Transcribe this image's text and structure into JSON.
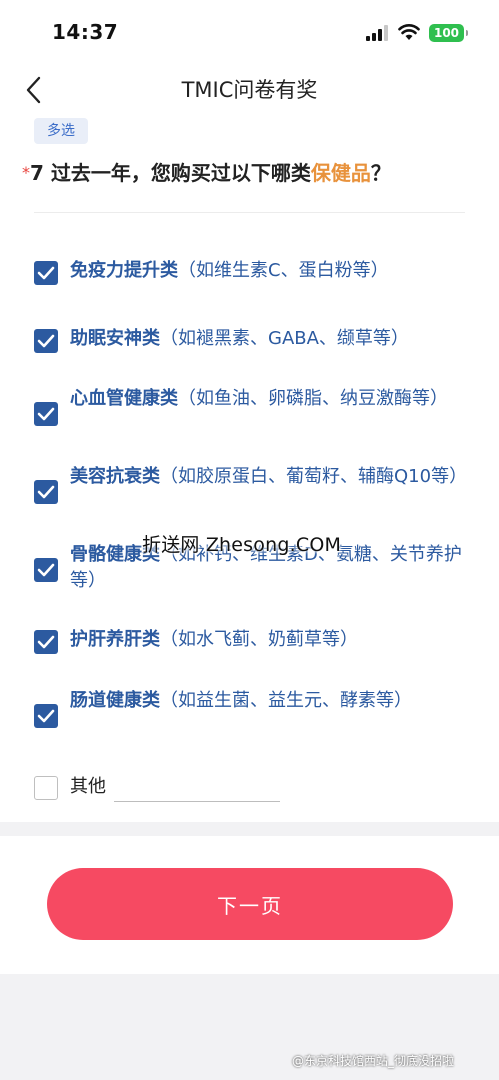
{
  "status_bar": {
    "time": "14:37",
    "battery": "100"
  },
  "nav": {
    "title": "TMIC问卷有奖"
  },
  "question": {
    "tag": "多选",
    "required_mark": "*",
    "text_before": "7 过去一年，您购买过以下哪类",
    "text_highlight": "保健品",
    "text_after": "？"
  },
  "options": [
    {
      "name": "免疫力提升类",
      "detail": "（如维生素C、蛋白粉等）",
      "checked": true
    },
    {
      "name": "助眠安神类",
      "detail": "（如褪黑素、GABA、缬草等）",
      "checked": true
    },
    {
      "name": "心血管健康类",
      "detail": "（如鱼油、卵磷脂、纳豆激酶等）",
      "checked": true
    },
    {
      "name": "美容抗衰类",
      "detail": "（如胶原蛋白、葡萄籽、辅酶Q10等）",
      "checked": true
    },
    {
      "name": "骨骼健康类",
      "detail": "（如补钙、维生素D、氨糖、关节养护等）",
      "checked": true
    },
    {
      "name": "护肝养肝类",
      "detail": "（如水飞蓟、奶蓟草等）",
      "checked": true
    },
    {
      "name": "肠道健康类",
      "detail": "（如益生菌、益生元、酵素等）",
      "checked": true
    }
  ],
  "other": {
    "label": "其他",
    "value": "",
    "checked": false
  },
  "watermark": "折送网 Zhesong.COM",
  "footer": {
    "next_label": "下一页",
    "credit": "@东京科技馆西站_彻底没招啦"
  },
  "colors": {
    "accent": "#2c5aa0",
    "highlight": "#e8923c",
    "button": "#f64a62",
    "required": "#e8443e"
  }
}
